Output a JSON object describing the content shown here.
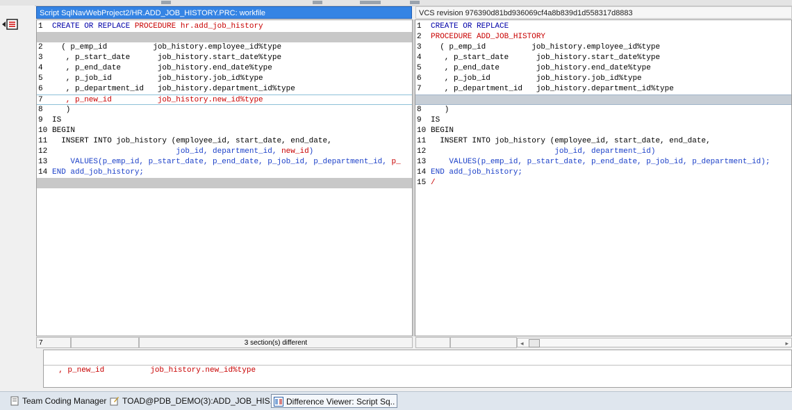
{
  "left_pane": {
    "title": "Script SqlNavWebProject2/HR.ADD_JOB_HISTORY.PRC: workfile",
    "lines": [
      {
        "n": "1",
        "segs": [
          {
            "t": "CREATE OR REPLACE ",
            "c": "kw"
          },
          {
            "t": "PROCEDURE hr.add_job_history",
            "c": "red"
          }
        ]
      },
      {
        "gap": true
      },
      {
        "n": "2",
        "segs": [
          {
            "t": "  ( p_emp_id          job_history.employee_id%type",
            "c": ""
          }
        ]
      },
      {
        "n": "3",
        "segs": [
          {
            "t": "   , p_start_date      job_history.start_date%type",
            "c": ""
          }
        ]
      },
      {
        "n": "4",
        "segs": [
          {
            "t": "   , p_end_date        job_history.end_date%type",
            "c": ""
          }
        ]
      },
      {
        "n": "5",
        "segs": [
          {
            "t": "   , p_job_id          job_history.job_id%type",
            "c": ""
          }
        ]
      },
      {
        "n": "6",
        "segs": [
          {
            "t": "   , p_department_id   job_history.department_id%type",
            "c": ""
          }
        ]
      },
      {
        "n": "7",
        "changed": true,
        "segs": [
          {
            "t": "   , p_new_id          job_history.new_id%type",
            "c": "red"
          }
        ]
      },
      {
        "n": "8",
        "segs": [
          {
            "t": "   )",
            "c": ""
          }
        ]
      },
      {
        "n": "9",
        "segs": [
          {
            "t": "IS",
            "c": ""
          }
        ]
      },
      {
        "n": "10",
        "segs": [
          {
            "t": "BEGIN",
            "c": ""
          }
        ]
      },
      {
        "n": "11",
        "segs": [
          {
            "t": "  INSERT INTO job_history (employee_id, start_date, end_date,",
            "c": ""
          }
        ]
      },
      {
        "n": "12",
        "segs": [
          {
            "t": "                           job_id, department_id, ",
            "c": "blue"
          },
          {
            "t": "new_id",
            "c": "red"
          },
          {
            "t": ")",
            "c": "blue"
          }
        ]
      },
      {
        "n": "13",
        "segs": [
          {
            "t": "    VALUES(p_emp_id, p_start_date, p_end_date, p_job_id, p_department_id, ",
            "c": "blue"
          },
          {
            "t": "p_",
            "c": "red"
          }
        ]
      },
      {
        "n": "14",
        "segs": [
          {
            "t": "END add_job_history;",
            "c": "blue"
          }
        ]
      },
      {
        "gap": true
      }
    ]
  },
  "right_pane": {
    "title": "VCS revision 976390d81bd936069cf4a8b839d1d558317d8883",
    "lines": [
      {
        "n": "1",
        "segs": [
          {
            "t": "CREATE OR REPLACE",
            "c": "kw"
          }
        ]
      },
      {
        "n": "2",
        "segs": [
          {
            "t": "PROCEDURE ADD_JOB_HISTORY",
            "c": "red"
          }
        ]
      },
      {
        "n": "3",
        "segs": [
          {
            "t": "  ( p_emp_id          job_history.employee_id%type",
            "c": ""
          }
        ]
      },
      {
        "n": "4",
        "segs": [
          {
            "t": "   , p_start_date      job_history.start_date%type",
            "c": ""
          }
        ]
      },
      {
        "n": "5",
        "segs": [
          {
            "t": "   , p_end_date        job_history.end_date%type",
            "c": ""
          }
        ]
      },
      {
        "n": "6",
        "segs": [
          {
            "t": "   , p_job_id          job_history.job_id%type",
            "c": ""
          }
        ]
      },
      {
        "n": "7",
        "segs": [
          {
            "t": "   , p_department_id   job_history.department_id%type",
            "c": ""
          }
        ]
      },
      {
        "gap": true,
        "blue": true
      },
      {
        "n": "8",
        "segs": [
          {
            "t": "   )",
            "c": ""
          }
        ]
      },
      {
        "n": "9",
        "segs": [
          {
            "t": "IS",
            "c": ""
          }
        ]
      },
      {
        "n": "10",
        "segs": [
          {
            "t": "BEGIN",
            "c": ""
          }
        ]
      },
      {
        "n": "11",
        "segs": [
          {
            "t": "  INSERT INTO job_history (employee_id, start_date, end_date,",
            "c": ""
          }
        ]
      },
      {
        "n": "12",
        "segs": [
          {
            "t": "                           job_id, department_id)",
            "c": "blue"
          }
        ]
      },
      {
        "n": "13",
        "segs": [
          {
            "t": "    VALUES(p_emp_id, p_start_date, p_end_date, p_job_id, p_department_id);",
            "c": "blue"
          }
        ]
      },
      {
        "n": "14",
        "segs": [
          {
            "t": "END add_job_history;",
            "c": "blue"
          }
        ]
      },
      {
        "n": "15",
        "segs": [
          {
            "t": "/",
            "c": "red"
          }
        ]
      }
    ]
  },
  "status": {
    "cursor_line": "7",
    "sections_text": "3 section(s) different"
  },
  "bottom_panel": {
    "line_text": "  , p_new_id          job_history.new_id%type"
  },
  "taskbar": {
    "items": [
      {
        "label": "Team Coding Manager"
      },
      {
        "label": "TOAD@PDB_DEMO(3):ADD_JOB_HIS.."
      },
      {
        "label": "Difference Viewer: Script Sq.."
      }
    ]
  },
  "colors": {
    "header_active": "#3584e4",
    "keyword": "#0000a8",
    "diff_red": "#c80000",
    "code_blue": "#1a3fc8",
    "gap_gray": "#c8c8c8"
  },
  "icons": {
    "gutter": "diff-navigator-icon",
    "task1": "team-coding-icon",
    "task2": "editor-icon",
    "task3": "difference-viewer-icon"
  }
}
